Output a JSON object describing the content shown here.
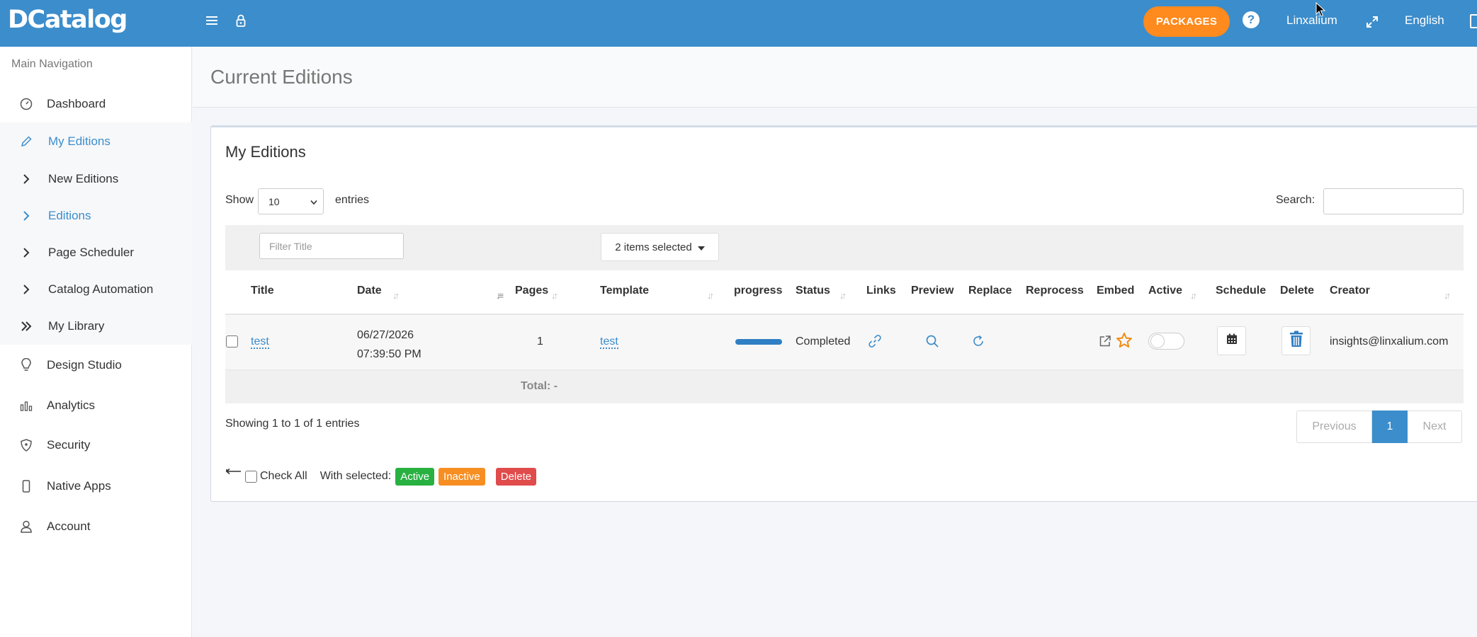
{
  "topbar": {
    "logo": "DCatalog",
    "packages": "PACKAGES",
    "help": "?",
    "user": "Linxalium",
    "language": "English"
  },
  "sidebar": {
    "header": "Main Navigation",
    "items": [
      {
        "label": "Dashboard",
        "icon": "gauge-icon"
      },
      {
        "label": "My Editions",
        "icon": "pencil-icon"
      },
      {
        "label": "New Editions",
        "icon": "chevron-right-icon"
      },
      {
        "label": "Editions",
        "icon": "chevron-right-icon"
      },
      {
        "label": "Page Scheduler",
        "icon": "chevron-right-icon"
      },
      {
        "label": "Catalog Automation",
        "icon": "chevron-right-icon"
      },
      {
        "label": "My Library",
        "icon": "double-chevron-right-icon"
      },
      {
        "label": "Design Studio",
        "icon": "lightbulb-icon"
      },
      {
        "label": "Analytics",
        "icon": "bar-chart-icon"
      },
      {
        "label": "Security",
        "icon": "shield-icon"
      },
      {
        "label": "Native Apps",
        "icon": "mobile-icon"
      },
      {
        "label": "Account",
        "icon": "user-icon"
      }
    ]
  },
  "page": {
    "title": "Current Editions"
  },
  "box": {
    "title": "My Editions",
    "show_label": "Show",
    "show_value": "10",
    "entries_label": "entries",
    "search_label": "Search:",
    "filter_title_placeholder": "Filter Title",
    "items_selected": "2 items selected"
  },
  "table": {
    "headers": [
      "Title",
      "Date",
      "Pages",
      "Template",
      "progress",
      "Status",
      "Links",
      "Preview",
      "Replace",
      "Reprocess",
      "Embed",
      "Active",
      "Schedule",
      "Delete",
      "Creator"
    ],
    "row": {
      "title": "test",
      "date_line1": "06/27/2026",
      "date_line2": "07:39:50 PM",
      "pages": "1",
      "template": "test",
      "progress": 1.0,
      "status": "Completed",
      "active": false,
      "creator": "insights@linxalium.com"
    },
    "total": "Total: -"
  },
  "footer": {
    "showing": "Showing 1 to 1 of 1 entries",
    "previous": "Previous",
    "page": "1",
    "next": "Next",
    "check_all": "Check All",
    "with_selected": "With selected:",
    "active_btn": "Active",
    "inactive_btn": "Inactive",
    "delete_btn": "Delete"
  },
  "colors": {
    "topbar": "#3c8dcb",
    "accent": "#3c8dcb",
    "packages": "#ff8a1d",
    "active_label": "#28b141",
    "inactive_label": "#f78e22",
    "delete_label": "#e04b4b"
  }
}
